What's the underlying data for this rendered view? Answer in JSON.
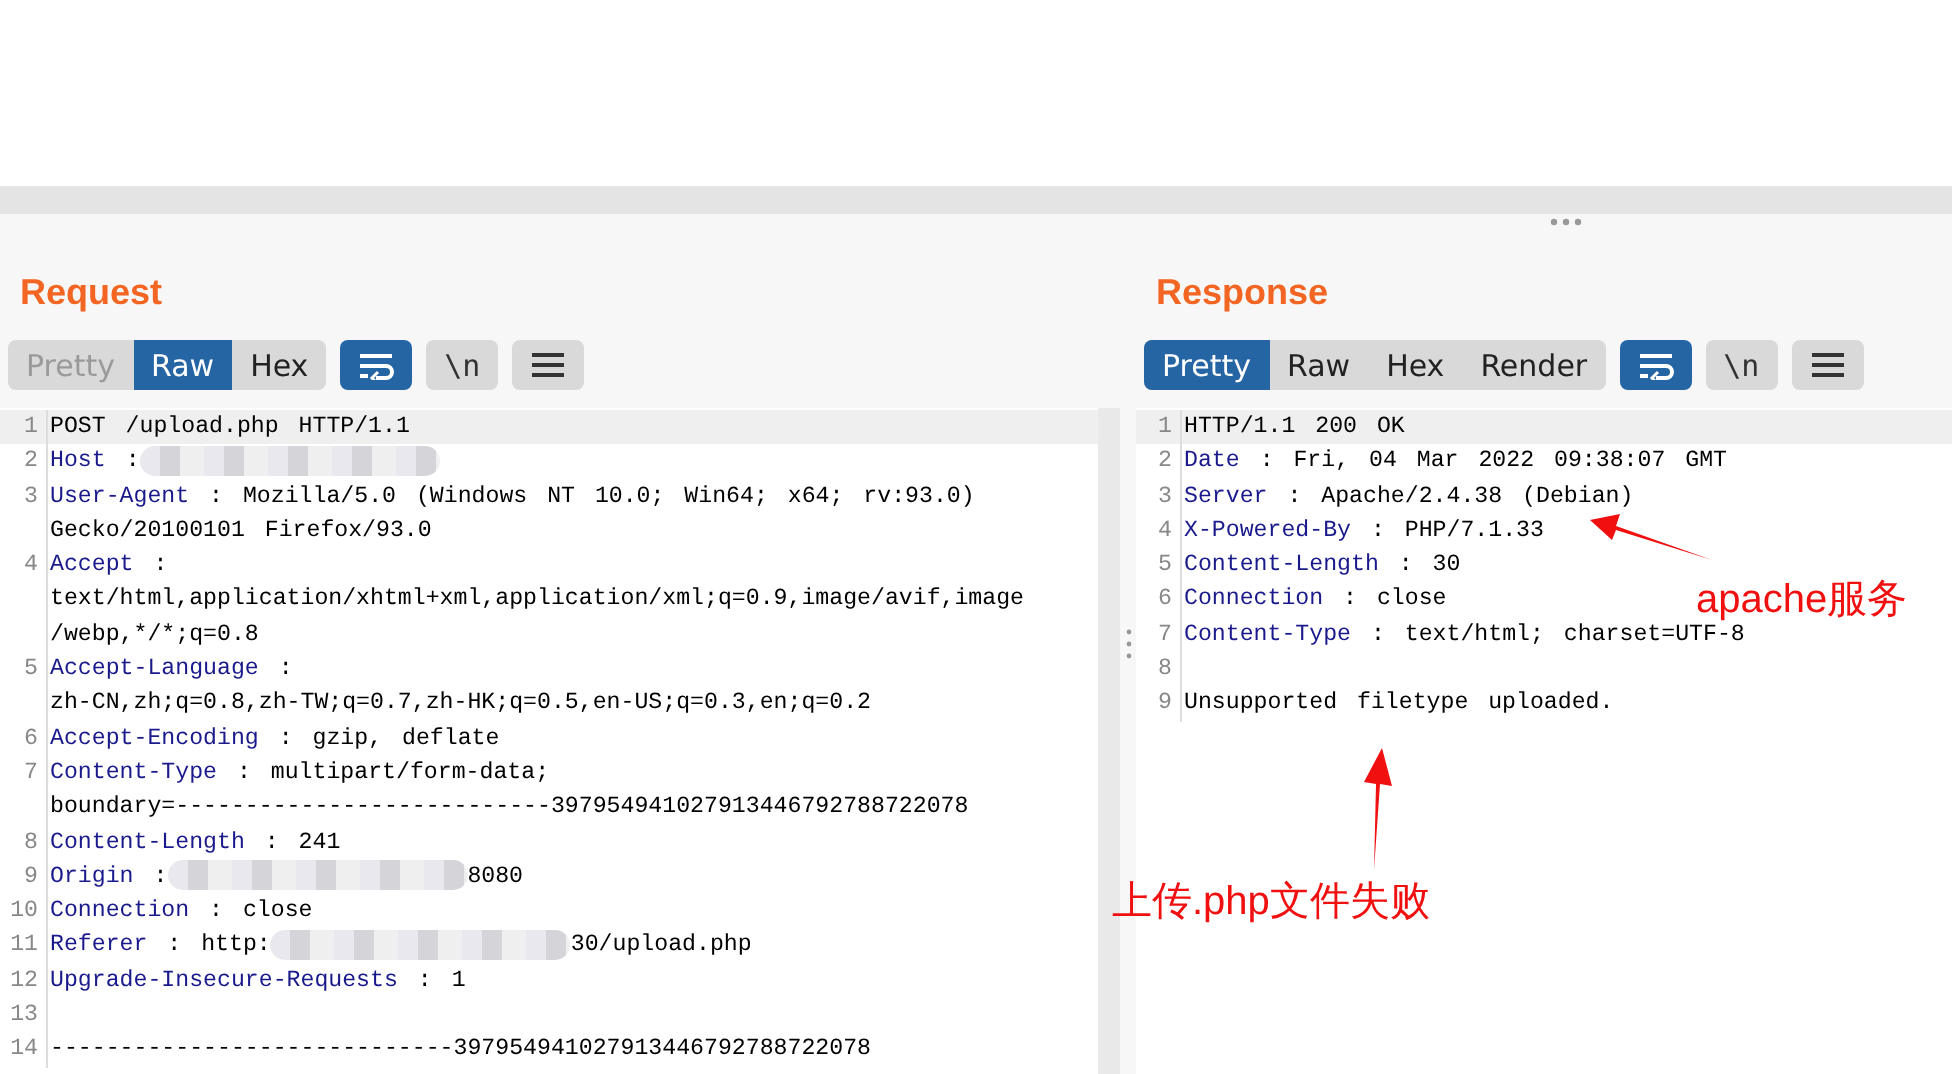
{
  "panels": [
    {
      "title": "Request",
      "view_tabs": [
        {
          "label": "Pretty",
          "selected": false,
          "disabled": true
        },
        {
          "label": "Raw",
          "selected": true,
          "disabled": false
        },
        {
          "label": "Hex",
          "selected": false,
          "disabled": false
        }
      ],
      "tools": [
        {
          "kind": "wrap",
          "on": true
        },
        {
          "kind": "newline",
          "label": "\\n",
          "on": false
        },
        {
          "kind": "menu",
          "on": false
        }
      ],
      "rows": [
        {
          "number": "1",
          "current": true,
          "kind": "text",
          "value": "POST /upload.php HTTP/1.1"
        },
        {
          "number": "2",
          "current": false,
          "kind": "header",
          "name": "Host",
          "segments": [
            {
              "kind": "text",
              "text": ":"
            },
            {
              "kind": "redacted"
            }
          ]
        },
        {
          "number": "3",
          "current": false,
          "kind": "header",
          "name": "User-Agent",
          "value": ": Mozilla/5.0 (Windows NT 10.0; Win64; x64; rv:93.0)"
        },
        {
          "current": false,
          "kind": "text",
          "value": "Gecko/20100101 Firefox/93.0"
        },
        {
          "number": "4",
          "current": false,
          "kind": "header",
          "name": "Accept",
          "value": ":"
        },
        {
          "current": false,
          "kind": "text",
          "value": "text/html,application/xhtml+xml,application/xml;q=0.9,image/avif,image"
        },
        {
          "current": false,
          "kind": "text",
          "value": "/webp,*/*;q=0.8"
        },
        {
          "number": "5",
          "current": false,
          "kind": "header",
          "name": "Accept-Language",
          "value": ":"
        },
        {
          "current": false,
          "kind": "text",
          "value": "zh-CN,zh;q=0.8,zh-TW;q=0.7,zh-HK;q=0.5,en-US;q=0.3,en;q=0.2"
        },
        {
          "number": "6",
          "current": false,
          "kind": "header",
          "name": "Accept-Encoding",
          "value": ": gzip, deflate"
        },
        {
          "number": "7",
          "current": false,
          "kind": "header",
          "name": "Content-Type",
          "value": ": multipart/form-data;"
        },
        {
          "current": false,
          "kind": "text",
          "value": "boundary=---------------------------397954941027913446792788722078"
        },
        {
          "number": "8",
          "current": false,
          "kind": "header",
          "name": "Content-Length",
          "value": ": 241"
        },
        {
          "number": "9",
          "current": false,
          "kind": "header",
          "name": "Origin",
          "segments": [
            {
              "kind": "text",
              "text": ":"
            },
            {
              "kind": "redacted"
            },
            {
              "kind": "text",
              "text": "8080"
            }
          ]
        },
        {
          "number": "10",
          "current": false,
          "kind": "header",
          "name": "Connection",
          "value": ": close"
        },
        {
          "number": "11",
          "current": false,
          "kind": "header",
          "name": "Referer",
          "segments": [
            {
              "kind": "text",
              "text": ": http:"
            },
            {
              "kind": "redacted"
            },
            {
              "kind": "text",
              "text": "30/upload.php"
            }
          ]
        },
        {
          "number": "12",
          "current": false,
          "kind": "header",
          "name": "Upgrade-Insecure-Requests",
          "value": ": 1"
        },
        {
          "number": "13",
          "current": false,
          "kind": "blank"
        },
        {
          "number": "14",
          "current": false,
          "kind": "text",
          "value": "-----------------------------397954941027913446792788722078"
        }
      ]
    },
    {
      "title": "Response",
      "view_tabs": [
        {
          "label": "Pretty",
          "selected": true,
          "disabled": false
        },
        {
          "label": "Raw",
          "selected": false,
          "disabled": false
        },
        {
          "label": "Hex",
          "selected": false,
          "disabled": false
        },
        {
          "label": "Render",
          "selected": false,
          "disabled": false
        }
      ],
      "tools": [
        {
          "kind": "wrap",
          "on": true
        },
        {
          "kind": "newline",
          "label": "\\n",
          "on": false
        },
        {
          "kind": "menu",
          "on": false
        }
      ],
      "rows": [
        {
          "number": "1",
          "current": true,
          "kind": "text",
          "value": "HTTP/1.1 200 OK"
        },
        {
          "number": "2",
          "current": false,
          "kind": "header",
          "name": "Date",
          "value": ": Fri, 04 Mar 2022 09:38:07 GMT"
        },
        {
          "number": "3",
          "current": false,
          "kind": "header",
          "name": "Server",
          "value": ": Apache/2.4.38 (Debian)"
        },
        {
          "number": "4",
          "current": false,
          "kind": "header",
          "name": "X-Powered-By",
          "value": ": PHP/7.1.33"
        },
        {
          "number": "5",
          "current": false,
          "kind": "header",
          "name": "Content-Length",
          "value": ": 30"
        },
        {
          "number": "6",
          "current": false,
          "kind": "header",
          "name": "Connection",
          "value": ": close"
        },
        {
          "number": "7",
          "current": false,
          "kind": "header",
          "name": "Content-Type",
          "value": ": text/html; charset=UTF-8"
        },
        {
          "number": "8",
          "current": false,
          "kind": "blank"
        },
        {
          "number": "9",
          "current": false,
          "kind": "text",
          "value": "Unsupported filetype uploaded."
        }
      ]
    }
  ],
  "annotations": [
    {
      "text": "apache服务"
    },
    {
      "text": "上传.php文件失败"
    }
  ]
}
